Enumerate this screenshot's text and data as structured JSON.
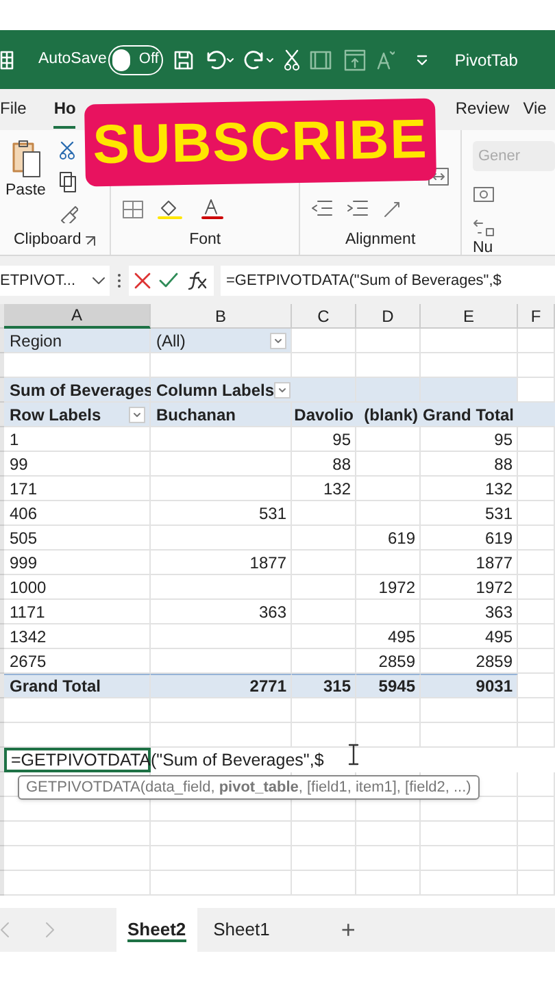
{
  "title_bar": {
    "autosave_label": "AutoSave",
    "autosave": {
      "on": false,
      "label": "Off"
    },
    "title": "PivotTab"
  },
  "ribbon_tabs": [
    {
      "label": "File",
      "selected": false
    },
    {
      "label": "Ho",
      "selected": true
    },
    {
      "label": "Review",
      "selected": false
    },
    {
      "label": "Vie",
      "selected": false
    }
  ],
  "ribbon_groups": [
    {
      "kind": "clipboard",
      "label": "Clipboard",
      "button": "Paste"
    },
    {
      "kind": "font",
      "label": "Font"
    },
    {
      "kind": "alignment",
      "label": "Alignment"
    },
    {
      "kind": "number",
      "label": "Nu",
      "format_placeholder": "Gener"
    }
  ],
  "overlay": "SUBSCRIBE",
  "formula_bar": {
    "name_box": "ETPIVOT...",
    "formula": "=GETPIVOTDATA(\"Sum of Beverages\",$"
  },
  "columns": [
    {
      "label": "A",
      "selected": true
    },
    {
      "label": "B",
      "selected": false
    },
    {
      "label": "C",
      "selected": false
    },
    {
      "label": "D",
      "selected": false
    },
    {
      "label": "E",
      "selected": false
    },
    {
      "label": "F",
      "selected": false
    }
  ],
  "rows": [
    {
      "kind": "filter",
      "cells": [
        "Region",
        "(All)"
      ]
    },
    {
      "kind": "blank"
    },
    {
      "kind": "pivot_header",
      "cells": [
        "Sum of Beverages",
        "Column Labels"
      ]
    },
    {
      "kind": "pivot_columns",
      "cells": [
        "Row Labels",
        "Buchanan",
        "Davolio",
        "(blank)",
        "Grand Total"
      ]
    },
    {
      "kind": "data",
      "cells": [
        "1",
        null,
        "95",
        null,
        "95"
      ]
    },
    {
      "kind": "data",
      "cells": [
        "99",
        null,
        "88",
        null,
        "88"
      ]
    },
    {
      "kind": "data",
      "cells": [
        "171",
        null,
        "132",
        null,
        "132"
      ]
    },
    {
      "kind": "data",
      "cells": [
        "406",
        "531",
        null,
        null,
        "531"
      ]
    },
    {
      "kind": "data",
      "cells": [
        "505",
        null,
        null,
        "619",
        "619"
      ]
    },
    {
      "kind": "data",
      "cells": [
        "999",
        "1877",
        null,
        null,
        "1877"
      ]
    },
    {
      "kind": "data",
      "cells": [
        "1000",
        null,
        null,
        "1972",
        "1972"
      ]
    },
    {
      "kind": "data",
      "cells": [
        "1171",
        "363",
        null,
        null,
        "363"
      ]
    },
    {
      "kind": "data",
      "cells": [
        "1342",
        null,
        null,
        "495",
        "495"
      ]
    },
    {
      "kind": "data",
      "cells": [
        "2675",
        null,
        null,
        "2859",
        "2859"
      ]
    },
    {
      "kind": "total",
      "cells": [
        "Grand Total",
        "2771",
        "315",
        "5945",
        "9031"
      ]
    },
    {
      "kind": "blank"
    },
    {
      "kind": "blank"
    },
    {
      "kind": "edit",
      "formula": "=GETPIVOTDATA(\"Sum of Beverages\",$",
      "tooltip": "GETPIVOTDATA(data_field, **pivot_table**, [field1, item1], [field2, ...)"
    },
    {
      "kind": "blank"
    },
    {
      "kind": "blank"
    },
    {
      "kind": "blank"
    },
    {
      "kind": "blank"
    },
    {
      "kind": "blank"
    }
  ],
  "sheet_tabs": [
    {
      "label": "Sheet2",
      "selected": true
    },
    {
      "label": "Sheet1",
      "selected": false
    }
  ],
  "new_sheet": "+"
}
